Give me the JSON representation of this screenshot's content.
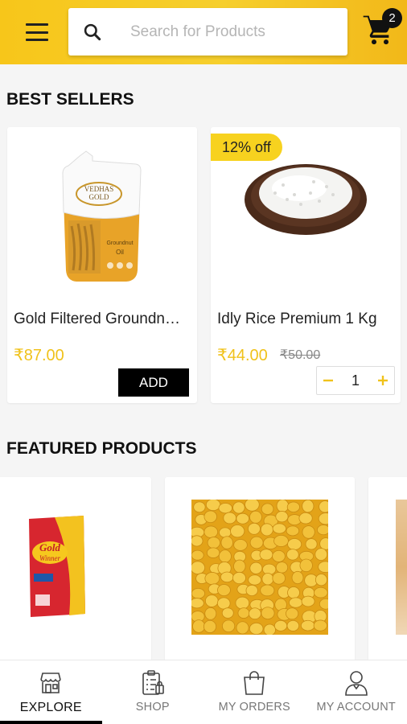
{
  "header": {
    "search_placeholder": "Search for Products",
    "cart_count": "2"
  },
  "best_sellers": {
    "title": "BEST SELLERS",
    "products": [
      {
        "name": "Gold Filtered Groundnut Oil",
        "price": "₹87.00",
        "action": "ADD",
        "image": "groundnut-oil-pouch"
      },
      {
        "name": "Idly Rice Premium 1 Kg",
        "price": "₹44.00",
        "mrp": "₹50.00",
        "discount": "12% off",
        "quantity": "1",
        "image": "idly-rice-bowl"
      }
    ]
  },
  "featured": {
    "title": "FEATURED PRODUCTS",
    "products": [
      {
        "image": "gold-winner-oil-pack"
      },
      {
        "image": "chana-dal"
      },
      {
        "image": "partial-product"
      }
    ]
  },
  "bottom_nav": {
    "items": [
      {
        "label": "EXPLORE",
        "icon": "store-icon",
        "active": true
      },
      {
        "label": "SHOP",
        "icon": "clipboard-list-icon",
        "active": false
      },
      {
        "label": "MY ORDERS",
        "icon": "shopping-bag-icon",
        "active": false
      },
      {
        "label": "MY ACCOUNT",
        "icon": "user-icon",
        "active": false
      }
    ]
  },
  "colors": {
    "brand_yellow": "#f7c61a",
    "price_yellow": "#f0c21b",
    "badge_yellow": "#f7d21f",
    "dark": "#111111"
  }
}
